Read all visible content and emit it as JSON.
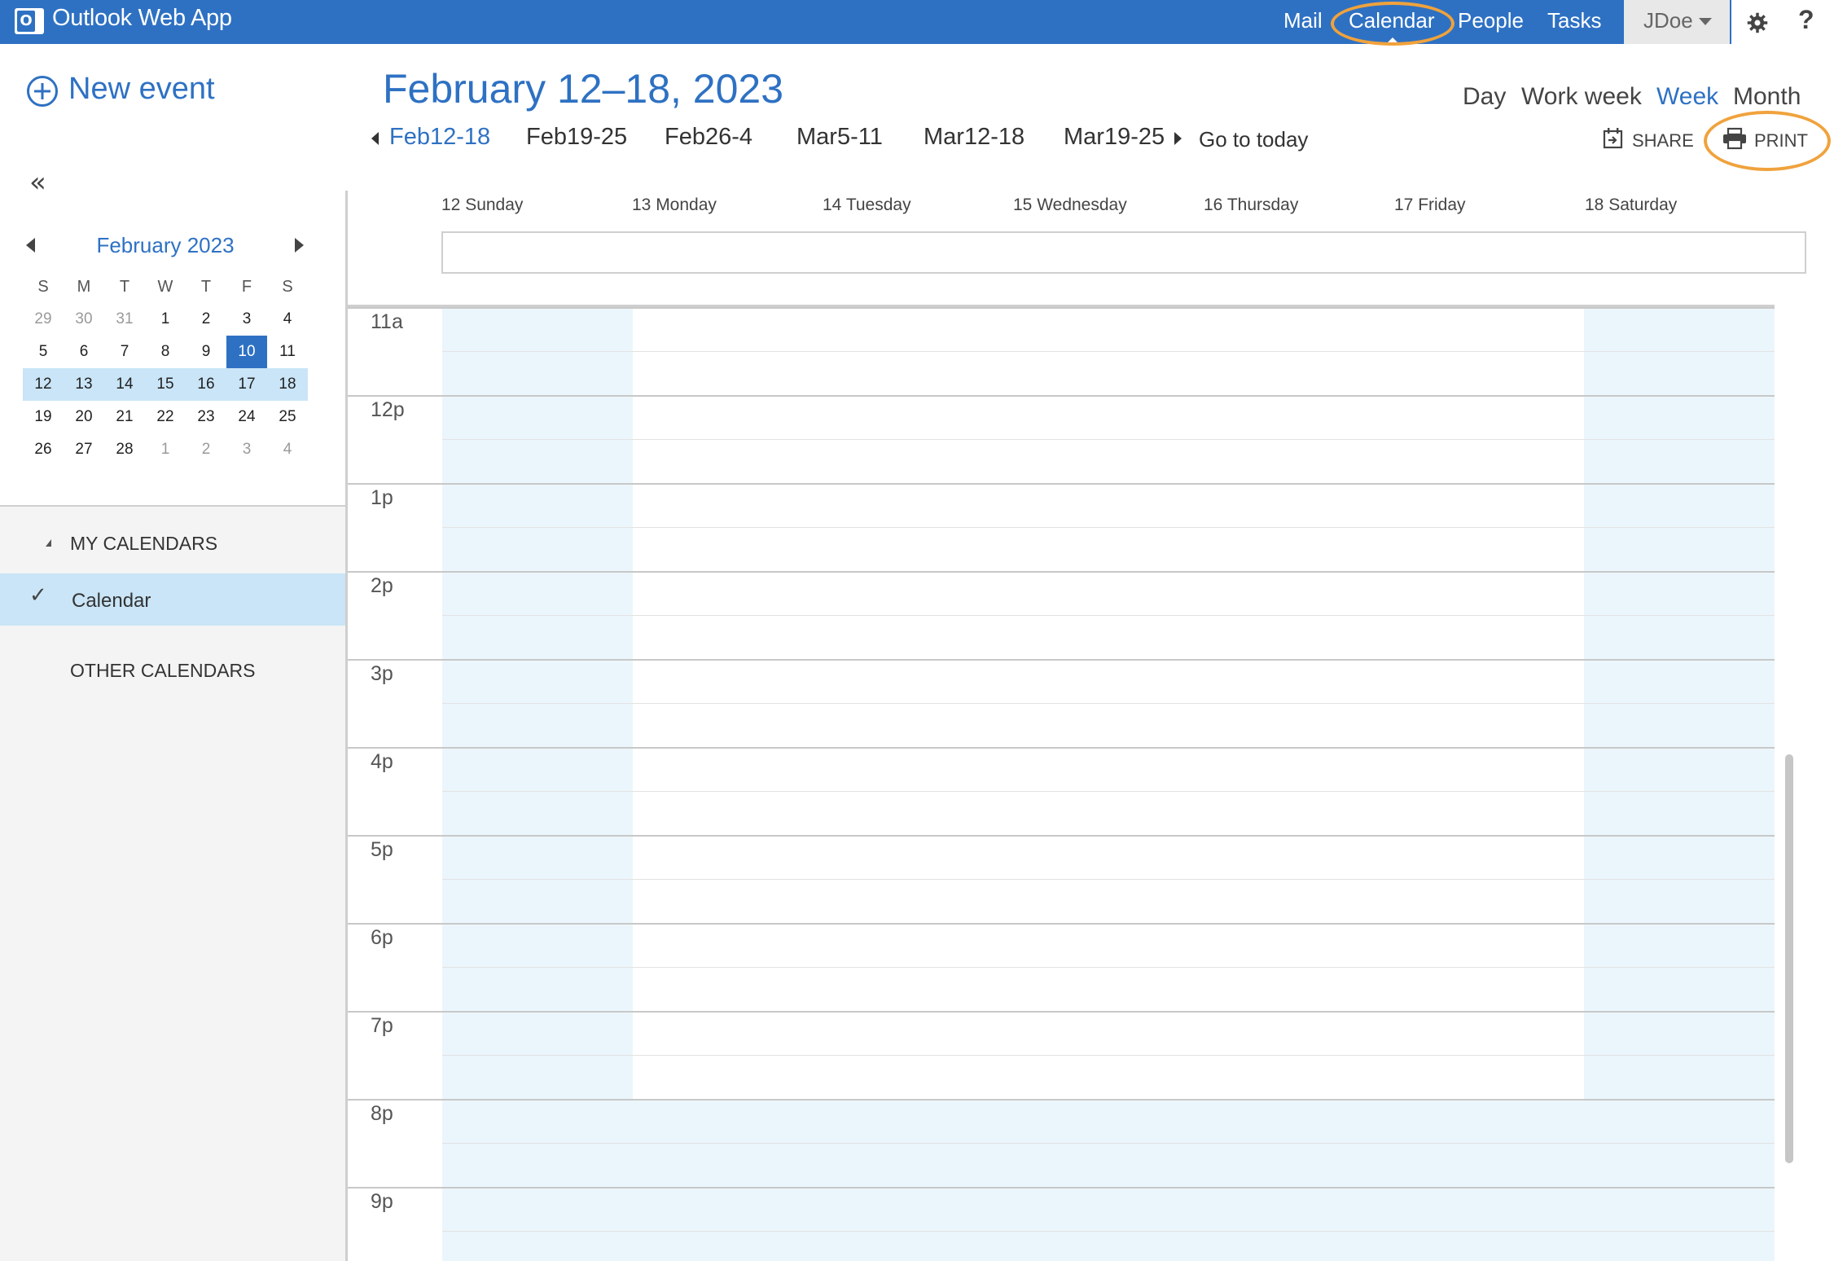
{
  "app": {
    "title": "Outlook Web App",
    "logo_letter": "O"
  },
  "topnav": {
    "items": [
      "Mail",
      "Calendar",
      "People",
      "Tasks"
    ],
    "active": "Calendar",
    "user": "JDoe",
    "help": "?"
  },
  "left": {
    "new_event": "New event",
    "collapse": "«",
    "mini_calendar": {
      "title": "February 2023",
      "dow": [
        "S",
        "M",
        "T",
        "W",
        "T",
        "F",
        "S"
      ],
      "weeks": [
        [
          "29",
          "30",
          "31",
          "1",
          "2",
          "3",
          "4"
        ],
        [
          "5",
          "6",
          "7",
          "8",
          "9",
          "10",
          "11"
        ],
        [
          "12",
          "13",
          "14",
          "15",
          "16",
          "17",
          "18"
        ],
        [
          "19",
          "20",
          "21",
          "22",
          "23",
          "24",
          "25"
        ],
        [
          "26",
          "27",
          "28",
          "1",
          "2",
          "3",
          "4"
        ]
      ],
      "today": "10",
      "selected_week_index": 2
    },
    "my_calendars": "MY CALENDARS",
    "calendar_item": "Calendar",
    "other_calendars": "OTHER CALENDARS"
  },
  "header": {
    "range_title": "February 12–18, 2023",
    "views": [
      "Day",
      "Work week",
      "Week",
      "Month"
    ],
    "active_view": "Week",
    "weeks": [
      "Feb12-18",
      "Feb19-25",
      "Feb26-4",
      "Mar5-11",
      "Mar12-18",
      "Mar19-25"
    ],
    "go_today": "Go to today",
    "share": "SHARE",
    "print": "PRINT"
  },
  "grid": {
    "days": [
      "12 Sunday",
      "13 Monday",
      "14 Tuesday",
      "15 Wednesday",
      "16 Thursday",
      "17 Friday",
      "18 Saturday"
    ],
    "hours": [
      "11a",
      "12p",
      "1p",
      "2p",
      "3p",
      "4p",
      "5p",
      "6p",
      "7p",
      "8p",
      "9p"
    ]
  },
  "colors": {
    "brand": "#2e71c3",
    "highlight_ring": "#f0a23c",
    "nonwork_shade": "#ebf6fc",
    "selected_week": "#c9e5f7"
  }
}
